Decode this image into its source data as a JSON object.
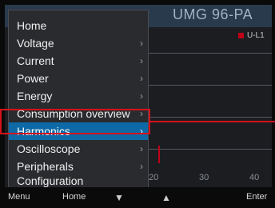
{
  "header": {
    "device_title": "UMG 96-PA"
  },
  "legend": {
    "label": "U-L1",
    "color": "#c00018"
  },
  "axis": {
    "ticks": [
      "20",
      "30",
      "40"
    ]
  },
  "menu": {
    "selected_color": "#0d6aa7",
    "items": [
      {
        "label": "Home",
        "chevron": ""
      },
      {
        "label": "Voltage",
        "chevron": "›"
      },
      {
        "label": "Current",
        "chevron": "›"
      },
      {
        "label": "Power",
        "chevron": "›"
      },
      {
        "label": "Energy",
        "chevron": "›"
      },
      {
        "label": "Consumption overview",
        "chevron": "›"
      },
      {
        "label": "Harmonics",
        "chevron": "›"
      },
      {
        "label": "Oscilloscope",
        "chevron": "›"
      },
      {
        "label": "Peripherals",
        "chevron": "›"
      },
      {
        "label": "Configuration",
        "chevron": ""
      }
    ]
  },
  "bottom_bar": {
    "menu_label": "Menu",
    "home_label": "Home",
    "down_icon": "▼",
    "up_icon": "▲",
    "enter_label": "Enter"
  },
  "annotation": {
    "highlight_color": "#d4121a"
  }
}
